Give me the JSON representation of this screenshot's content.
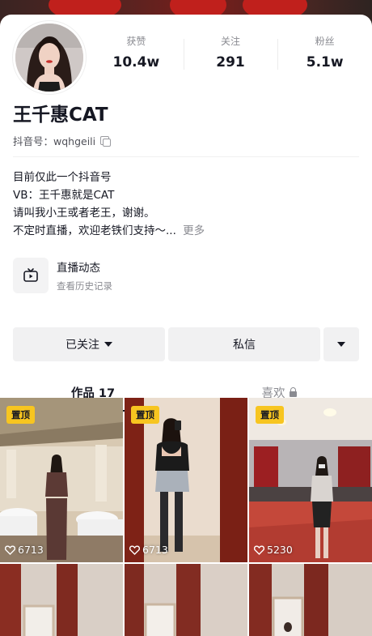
{
  "profile": {
    "name": "王千惠CAT",
    "douyin_id": "抖音号：wqhgeili",
    "stats": [
      {
        "label": "获赞",
        "value": "10.4w"
      },
      {
        "label": "关注",
        "value": "291"
      },
      {
        "label": "粉丝",
        "value": "5.1w"
      }
    ],
    "bio": [
      "目前仅此一个抖音号",
      "VB：王千惠就是CAT",
      "请叫我小王或者老王，谢谢。",
      "不定时直播，欢迎老铁们支持～..."
    ],
    "bio_more": "更多"
  },
  "live": {
    "title": "直播动态",
    "subtitle": "查看历史记录"
  },
  "actions": {
    "follow_label": "已关注",
    "message_label": "私信"
  },
  "tabs": [
    {
      "label": "作品 17",
      "active": true
    },
    {
      "label": "喜欢",
      "active": false,
      "locked": true
    }
  ],
  "videos": [
    {
      "pinned_label": "置顶",
      "likes": "6713"
    },
    {
      "pinned_label": "置顶",
      "likes": "6713"
    },
    {
      "pinned_label": "置顶",
      "likes": "5230"
    },
    {
      "pinned_label": "",
      "likes": ""
    },
    {
      "pinned_label": "",
      "likes": ""
    },
    {
      "pinned_label": "",
      "likes": ""
    }
  ],
  "colors": {
    "pin_badge": "#f7c520",
    "text_primary": "#161823",
    "text_secondary": "#8a8b91",
    "button_bg": "#f1f1f2"
  }
}
